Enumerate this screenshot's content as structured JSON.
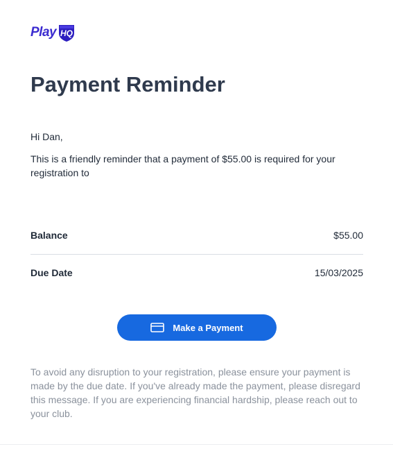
{
  "brand": {
    "logo_text": "Play",
    "logo_badge_text": "HQ",
    "color_primary": "#3b2bd0",
    "icon": "playhq-shield-logo"
  },
  "email": {
    "title": "Payment Reminder",
    "greeting": "Hi Dan,",
    "message": "This is a friendly reminder that a payment of $55.00 is required for your registration to",
    "details": [
      {
        "label": "Balance",
        "value": "$55.00"
      },
      {
        "label": "Due Date",
        "value": "15/03/2025"
      }
    ],
    "cta": {
      "label": "Make a Payment",
      "icon": "credit-card-icon",
      "color": "#1769e0"
    },
    "footer": "To avoid any disruption to your registration, please ensure your payment is made by the due date. If you've already made the payment, please disregard this message. If you are experiencing financial hardship, please reach out to your club."
  }
}
